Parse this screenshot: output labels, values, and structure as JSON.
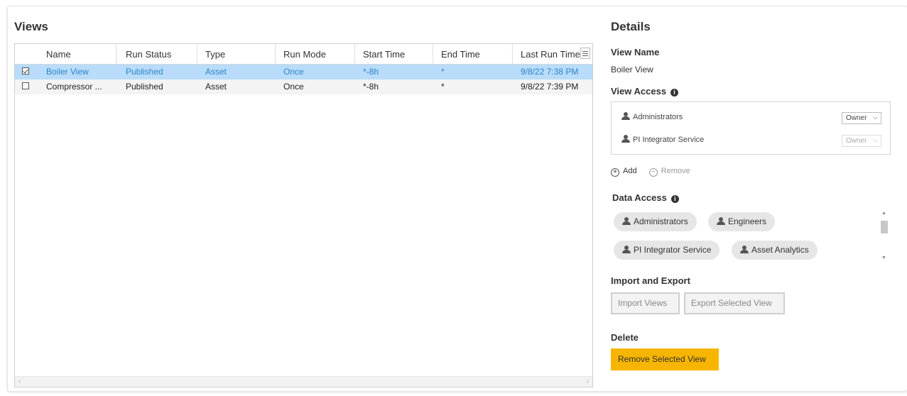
{
  "views_panel": {
    "title": "Views",
    "columns": [
      "Name",
      "Run Status",
      "Type",
      "Run Mode",
      "Start Time",
      "End Time",
      "Last Run Time"
    ],
    "rows": [
      {
        "selected": true,
        "name": "Boiler View",
        "run_status": "Published",
        "type": "Asset",
        "run_mode": "Once",
        "start_time": "*-8h",
        "end_time": "*",
        "last_run_time": "9/8/22 7:38 PM"
      },
      {
        "selected": false,
        "name": "Compressor ...",
        "run_status": "Published",
        "type": "Asset",
        "run_mode": "Once",
        "start_time": "*-8h",
        "end_time": "*",
        "last_run_time": "9/8/22 7:39 PM"
      }
    ],
    "scroll_left": "‹",
    "scroll_right": "›"
  },
  "details": {
    "title": "Details",
    "view_name_label": "View Name",
    "view_name_value": "Boiler View",
    "view_access_label": "View Access",
    "info_glyph": "i",
    "view_access": [
      {
        "name": "Administrators",
        "role": "Owner",
        "enabled": true
      },
      {
        "name": "PI Integrator Service",
        "role": "Owner",
        "enabled": false
      }
    ],
    "add_label": "Add",
    "remove_label": "Remove",
    "add_glyph": "+",
    "remove_glyph": "−",
    "data_access_label": "Data Access",
    "data_access": [
      "Administrators",
      "Engineers",
      "PI Integrator Service",
      "Asset Analytics"
    ],
    "import_export_label": "Import and Export",
    "import_button": "Import Views",
    "export_button": "Export Selected View",
    "delete_label": "Delete",
    "remove_view_button": "Remove Selected View",
    "chevron_glyph": "⌵",
    "scroll_up_glyph": "▲",
    "scroll_down_glyph": "▼"
  },
  "colors": {
    "accent": "#f7b500",
    "selected_row": "#b8dcfa",
    "selected_text": "#2c84c9"
  }
}
